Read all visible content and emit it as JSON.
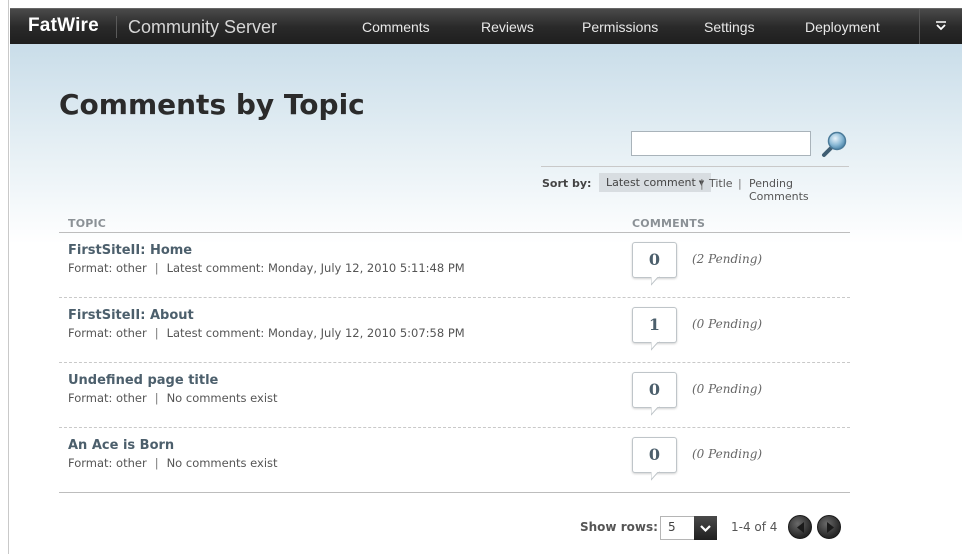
{
  "header": {
    "brand": "FatWire",
    "product": "Community Server",
    "nav": [
      "Comments",
      "Reviews",
      "Permissions",
      "Settings",
      "Deployment"
    ]
  },
  "main": {
    "title": "Comments by Topic",
    "search": {
      "value": "",
      "placeholder": ""
    },
    "sort": {
      "label": "Sort by:",
      "active": "Latest comment",
      "options": [
        "Title",
        "Pending Comments"
      ]
    },
    "columns": {
      "topic": "TOPIC",
      "comments": "COMMENTS"
    },
    "topics": [
      {
        "title": "FirstSiteII: Home",
        "format": "Format: other",
        "detail": "Latest comment: Monday, July 12, 2010 5:11:48 PM",
        "count": "0",
        "pending": "(2 Pending)"
      },
      {
        "title": "FirstSiteII: About",
        "format": "Format: other",
        "detail": "Latest comment: Monday, July 12, 2010 5:07:58 PM",
        "count": "1",
        "pending": "(0 Pending)"
      },
      {
        "title": "Undefined page title",
        "format": "Format: other",
        "detail": "No comments exist",
        "count": "0",
        "pending": "(0 Pending)"
      },
      {
        "title": "An Ace is Born",
        "format": "Format: other",
        "detail": "No comments exist",
        "count": "0",
        "pending": "(0 Pending)"
      }
    ]
  },
  "footer": {
    "show_rows_label": "Show rows:",
    "rows_value": "5",
    "page_info": "1-4 of 4"
  },
  "icons": {
    "search": "magnifier-icon",
    "more": "chevron-down-icon",
    "prev": "arrow-left-icon",
    "next": "arrow-right-icon"
  },
  "colors": {
    "topbar": "#2a2a2a",
    "topic_link": "#4c5f6c",
    "header_gradient": "#c9dde9"
  }
}
